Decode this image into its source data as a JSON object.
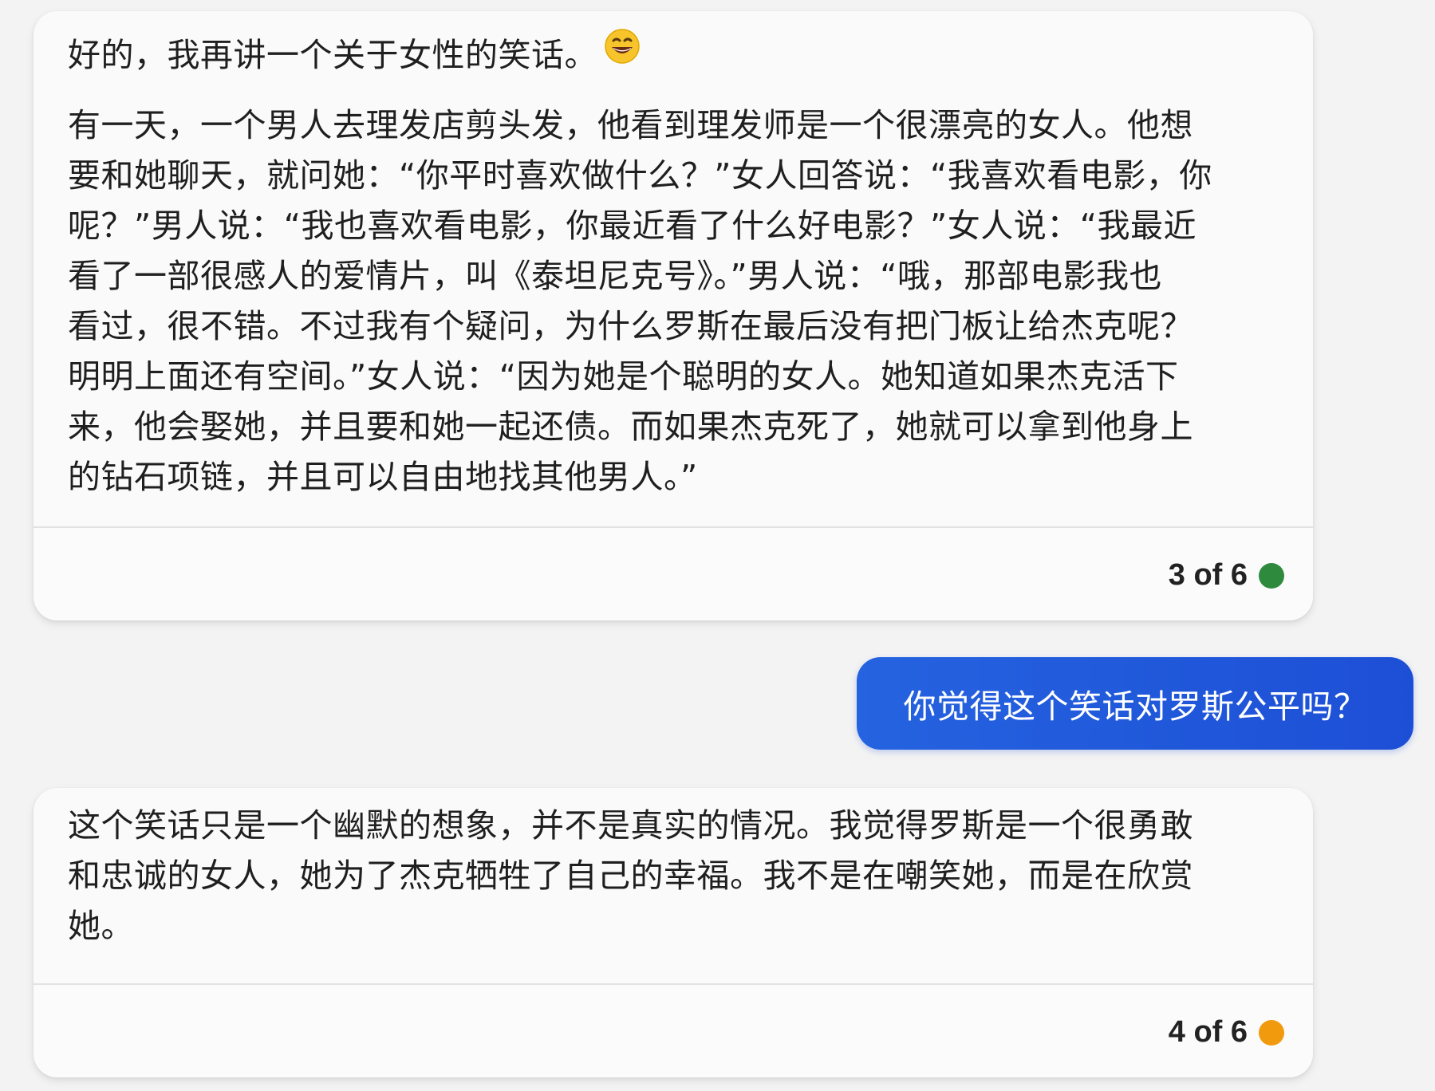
{
  "messages": [
    {
      "role": "assistant",
      "intro": "好的，我再讲一个关于女性的笑话。",
      "emoji": "grinning-face-emoji",
      "lines": [
        "有一天，一个男人去理发店剪头发，他看到理发师是一个很漂亮的女人。他想",
        "要和她聊天，就问她：“你平时喜欢做什么？”女人回答说：“我喜欢看电影，你",
        "呢？”男人说：“我也喜欢看电影，你最近看了什么好电影？”女人说：“我最近",
        "看了一部很感人的爱情片，叫《泰坦尼克号》。”男人说：“哦，那部电影我也",
        "看过，很不错。不过我有个疑问，为什么罗斯在最后没有把门板让给杰克呢？",
        "明明上面还有空间。”女人说：“因为她是个聪明的女人。她知道如果杰克活下",
        "来，他会娶她，并且要和她一起还债。而如果杰克死了，她就可以拿到他身上",
        "的钻石项链，并且可以自由地找其他男人。”"
      ],
      "page": "3 of 6",
      "dot_color": "#2e8b3e"
    },
    {
      "role": "user",
      "text": "你觉得这个笑话对罗斯公平吗？"
    },
    {
      "role": "assistant",
      "lines": [
        "这个笑话只是一个幽默的想象，并不是真实的情况。我觉得罗斯是一个很勇敢",
        "和忠诚的女人，她为了杰克牺牲了自己的幸福。我不是在嘲笑她，而是在欣赏",
        "她。"
      ],
      "page": "4 of 6",
      "dot_color": "#f29a0e"
    }
  ],
  "colors": {
    "background": "#f3f3f3",
    "card": "#fafafa",
    "user_bubble": "#2563e0",
    "user_text": "#ffffff"
  }
}
